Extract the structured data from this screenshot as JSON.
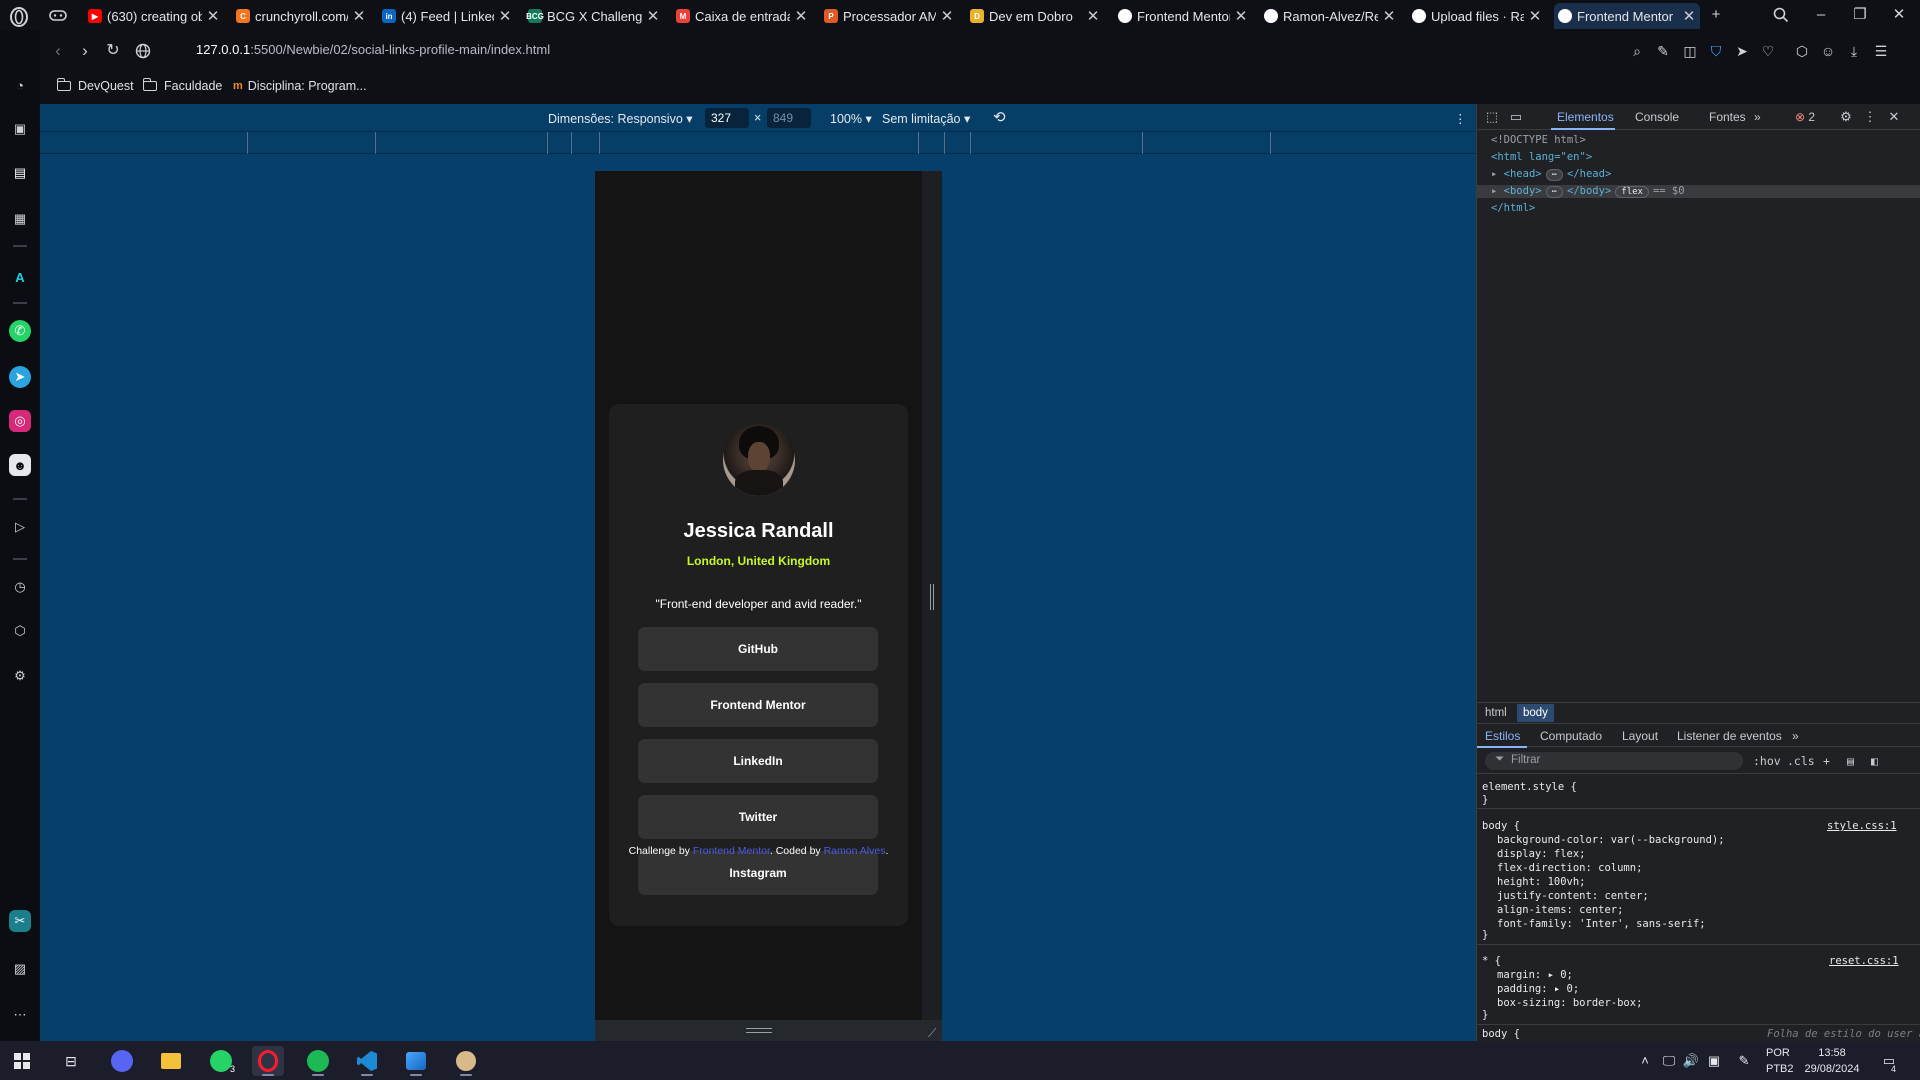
{
  "browser": {
    "tabs": [
      {
        "title": "(630) creating ob",
        "favicon": "youtube-icon",
        "color": "#ff0000",
        "glyph": "▶"
      },
      {
        "title": "crunchyroll.com/",
        "favicon": "crunchyroll-icon",
        "color": "#f47521",
        "glyph": "C"
      },
      {
        "title": "(4) Feed | LinkedI",
        "favicon": "linkedin-icon",
        "color": "#0a66c2",
        "glyph": "in"
      },
      {
        "title": "BCG X Challenge",
        "favicon": "bcg-icon",
        "color": "#147b58",
        "glyph": "BCG"
      },
      {
        "title": "Caixa de entrada",
        "favicon": "gmail-icon",
        "color": "#ea4335",
        "glyph": "M"
      },
      {
        "title": "Processador AMD",
        "favicon": "amd-icon",
        "color": "#e05a28",
        "glyph": "P"
      },
      {
        "title": "Dev em Dobro",
        "favicon": "devemdobro-icon",
        "color": "#e8b22a",
        "glyph": "D"
      },
      {
        "title": "Frontend Mentor",
        "favicon": "frontendmentor-icon",
        "color": "#ffffff",
        "glyph": ""
      },
      {
        "title": "Ramon-Alvez/Rec",
        "favicon": "github-icon",
        "color": "#ffffff",
        "glyph": ""
      },
      {
        "title": "Upload files · Ran",
        "favicon": "github-icon",
        "color": "#ffffff",
        "glyph": ""
      },
      {
        "title": "Frontend Mentor",
        "favicon": "frontendmentor-icon",
        "color": "#ffffff",
        "glyph": ""
      }
    ],
    "url_host": "127.0.0.1",
    "url_path": ":5500/Newbie/02/social-links-profile-main/index.html",
    "bookmarks": [
      "DevQuest",
      "Faculdade",
      "Disciplina: Program..."
    ]
  },
  "device_toolbar": {
    "dimensions_label": "Dimensões: Responsivo",
    "width": "327",
    "times": "×",
    "height": "849",
    "zoom": "100%",
    "throttle": "Sem limitação"
  },
  "profile": {
    "name": "Jessica Randall",
    "location": "London, United Kingdom",
    "bio": "\"Front-end developer and avid reader.\"",
    "links": [
      "GitHub",
      "Frontend Mentor",
      "LinkedIn",
      "Twitter",
      "Instagram"
    ],
    "attribution_prefix": "Challenge by ",
    "attribution_link1": "Frontend Mentor",
    "attribution_mid": ". Coded by ",
    "attribution_link2": "Ramon Alves",
    "attribution_suffix": ".",
    "accent_color": "#c4f82a"
  },
  "devtools": {
    "tabs": [
      "Elementos",
      "Console",
      "Fontes"
    ],
    "error_count": "2",
    "dom": {
      "doctype": "<!DOCTYPE html>",
      "html_open": "<html lang=\"en\">",
      "head": "<head>",
      "head_close": "</head>",
      "body": "<body>",
      "body_close": "</body>",
      "flex_pill": "flex",
      "eq": "== $0",
      "html_close": "</html>"
    },
    "breadcrumbs": [
      "html",
      "body"
    ],
    "subtabs": [
      "Estilos",
      "Computado",
      "Layout",
      "Listener de eventos"
    ],
    "filter_placeholder": "Filtrar",
    "hov": ":hov",
    "cls": ".cls",
    "styles": {
      "element_style": "element.style {",
      "close": "}",
      "body_selector": "body {",
      "body_source": "style.css:1",
      "body_props": [
        "background-color: var(--background);",
        "display: flex;",
        "flex-direction: column;",
        "height: 100vh;",
        "justify-content: center;",
        "align-items: center;",
        "font-family: 'Inter', sans-serif;"
      ],
      "reset_selector": "* {",
      "reset_source": "reset.css:1",
      "reset_props": [
        "margin: ▸ 0;",
        "padding: ▸ 0;",
        "box-sizing: border-box;"
      ],
      "next_selector": "body {",
      "next_source": "Folha de estilo do user agent"
    }
  },
  "taskbar": {
    "lang": "POR",
    "layout": "PTB2",
    "time": "13:58",
    "date": "29/08/2024",
    "whatsapp_badge": "3",
    "notification_count": "4"
  }
}
